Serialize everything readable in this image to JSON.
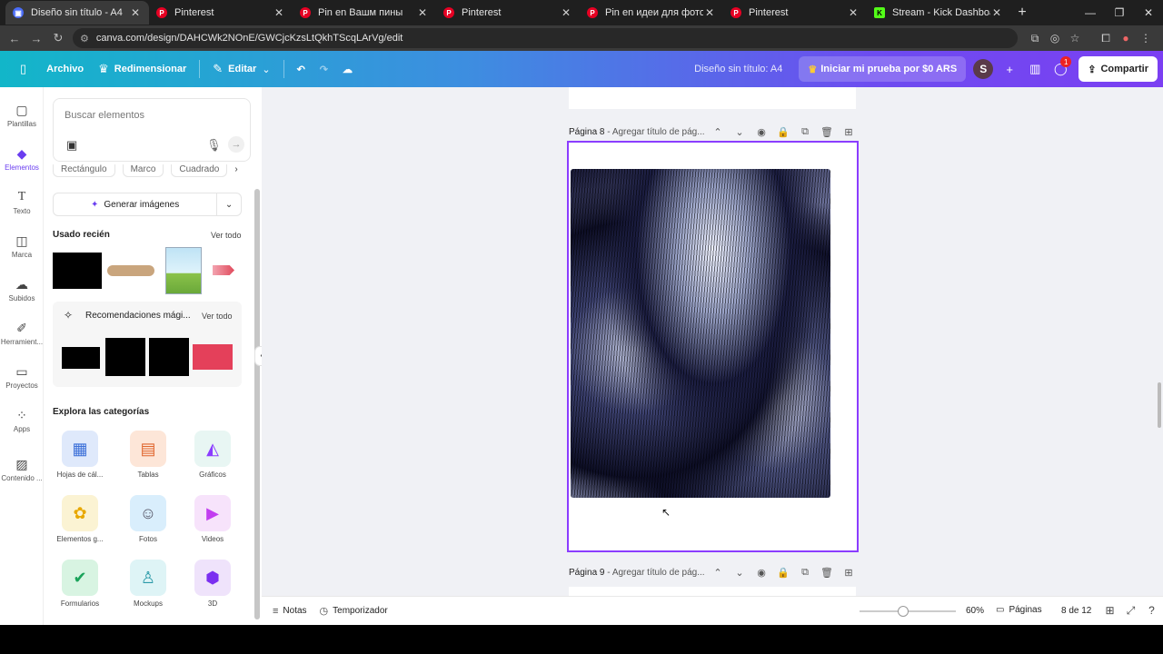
{
  "browser": {
    "tabs": [
      {
        "label": "Diseño sin título - A4",
        "active": true,
        "favicon": "canva-icon",
        "color": "#4a6cf7"
      },
      {
        "label": "Pinterest",
        "active": false,
        "favicon": "pinterest-icon",
        "color": "#e60023"
      },
      {
        "label": "Pin en Вашм пины",
        "active": false,
        "favicon": "pinterest-icon",
        "color": "#e60023"
      },
      {
        "label": "Pinterest",
        "active": false,
        "favicon": "pinterest-icon",
        "color": "#e60023"
      },
      {
        "label": "Pin en идеи для фото",
        "active": false,
        "favicon": "pinterest-icon",
        "color": "#e60023"
      },
      {
        "label": "Pinterest",
        "active": false,
        "favicon": "pinterest-icon",
        "color": "#e60023"
      },
      {
        "label": "Stream - Kick Dashboard",
        "active": false,
        "favicon": "kick-icon",
        "color": "#53fc18"
      }
    ],
    "url": "canva.com/design/DAHCWk2NOnE/GWCjcKzsLtQkhTScqLArVg/edit"
  },
  "header": {
    "file": "Archivo",
    "resize": "Redimensionar",
    "edit": "Editar",
    "doc_title": "Diseño sin título: A4",
    "trial": "Iniciar mi prueba por $0 ARS",
    "avatar_letter": "S",
    "notif_count": "1",
    "share": "Compartir"
  },
  "rail": [
    {
      "label": "Plantillas",
      "icon": "template-icon"
    },
    {
      "label": "Elementos",
      "icon": "elements-icon",
      "active": true
    },
    {
      "label": "Texto",
      "icon": "text-icon"
    },
    {
      "label": "Marca",
      "icon": "brand-icon"
    },
    {
      "label": "Subidos",
      "icon": "upload-icon"
    },
    {
      "label": "Herramient...",
      "icon": "tools-icon"
    },
    {
      "label": "Proyectos",
      "icon": "folder-icon"
    },
    {
      "label": "Apps",
      "icon": "apps-icon"
    },
    {
      "label": "Contenido ...",
      "icon": "content-icon"
    }
  ],
  "panel": {
    "search_placeholder": "Buscar elementos",
    "chips": [
      "Rectángulo",
      "Marco",
      "Cuadrado"
    ],
    "generate": "Generar imágenes",
    "recent_title": "Usado recién",
    "see_all": "Ver todo",
    "magic_title": "Recomendaciones mági...",
    "magic_see_all": "Ver todo",
    "categories_title": "Explora las categorías",
    "categories": [
      {
        "label": "Hojas de cál...",
        "icon": "sheet-icon",
        "color": "#dfe9fb"
      },
      {
        "label": "Tablas",
        "icon": "table-icon",
        "color": "#fde6d8"
      },
      {
        "label": "Gráficos",
        "icon": "chart-icon",
        "color": "#e8f6f3"
      },
      {
        "label": "Elementos g...",
        "icon": "sunflower-icon",
        "color": "#fbf3d3"
      },
      {
        "label": "Fotos",
        "icon": "photo-icon",
        "color": "#d9eefc"
      },
      {
        "label": "Videos",
        "icon": "play-icon",
        "color": "#f7e3fb"
      },
      {
        "label": "Formularios",
        "icon": "form-icon",
        "color": "#d8f4e2"
      },
      {
        "label": "Mockups",
        "icon": "tshirt-icon",
        "color": "#def4f6"
      },
      {
        "label": "3D",
        "icon": "cube-icon",
        "color": "#efe3fb"
      }
    ]
  },
  "canvas": {
    "page8_label": "Página 8",
    "page8_title": " - Agregar título de pág...",
    "page9_label": "Página 9",
    "page9_title": " - Agregar título de pág..."
  },
  "footer": {
    "notes": "Notas",
    "timer": "Temporizador",
    "zoom": "60%",
    "pages": "Páginas",
    "page_count": "8 de 12"
  }
}
